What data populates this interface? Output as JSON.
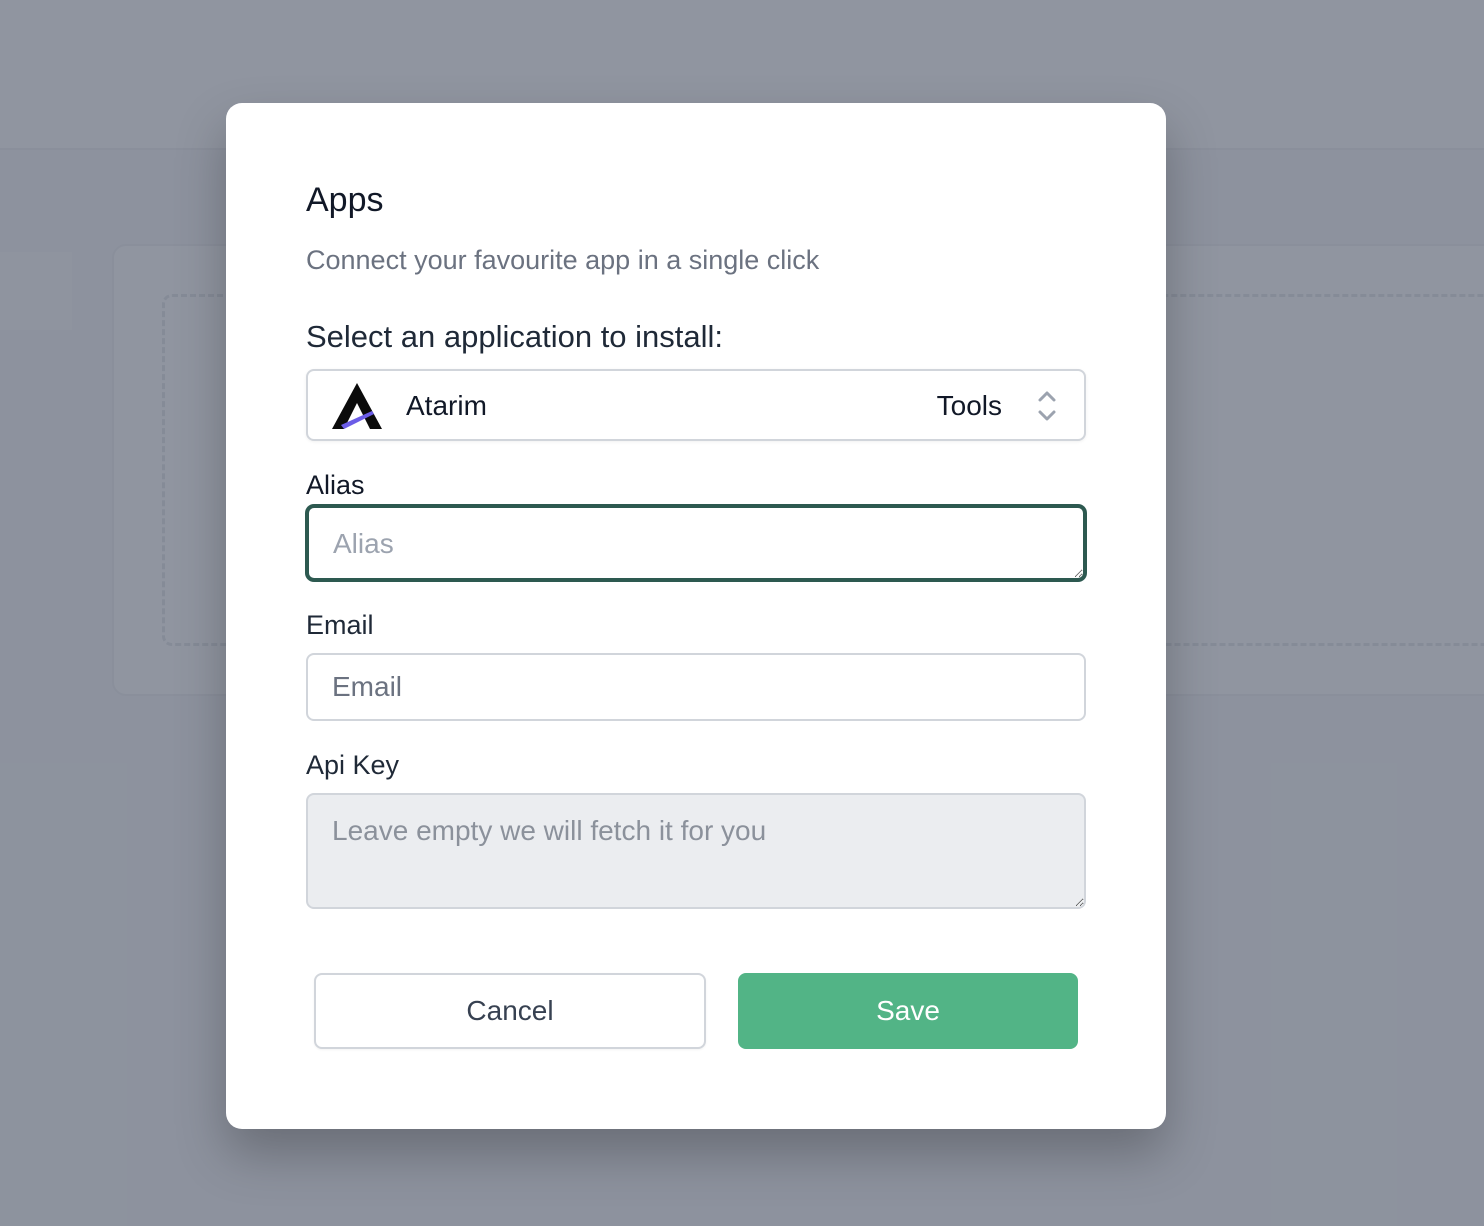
{
  "modal": {
    "title": "Apps",
    "subtitle": "Connect your favourite app in a single click",
    "select_label": "Select an application to install:",
    "app_select": {
      "selected_app": "Atarim",
      "category": "Tools",
      "logo_icon": "atarim-logo-icon",
      "chevron_icon": "chevron-up-down-icon"
    },
    "fields": {
      "alias": {
        "label": "Alias",
        "value": "",
        "placeholder": "Alias"
      },
      "email": {
        "label": "Email",
        "value": "",
        "placeholder": "Email"
      },
      "api_key": {
        "label": "Api Key",
        "value": "",
        "placeholder": "Leave empty we will fetch it for you"
      }
    },
    "buttons": {
      "cancel": "Cancel",
      "save": "Save"
    }
  },
  "colors": {
    "overlay": "#6b7280",
    "focus_border": "#2d5950",
    "save_button": "#52b486",
    "disabled_field": "#ebedf0"
  }
}
